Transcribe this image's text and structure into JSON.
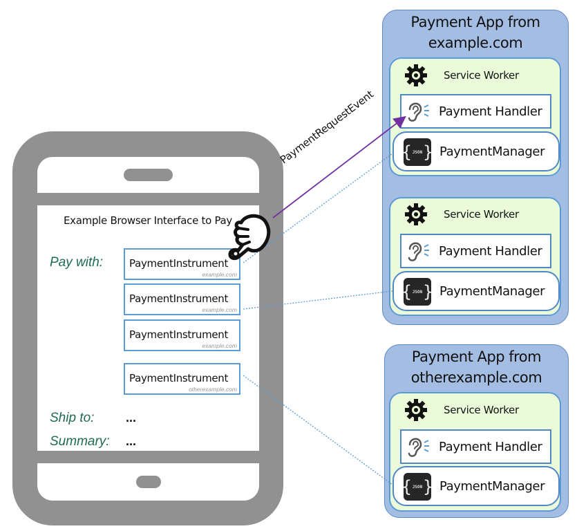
{
  "phone": {
    "browser_title": "Example Browser Interface to Pay",
    "pay_with_label": "Pay with:",
    "ship_to_label": "Ship to:",
    "ship_to_value": "...",
    "summary_label": "Summary:",
    "summary_value": "...",
    "instruments": [
      {
        "name": "PaymentInstrument",
        "origin": "example.com"
      },
      {
        "name": "PaymentInstrument",
        "origin": "example.com"
      },
      {
        "name": "PaymentInstrument",
        "origin": "example.com"
      },
      {
        "name": "PaymentInstrument",
        "origin": "otherexample.com"
      }
    ],
    "pointer_icon": "pointing-hand-icon"
  },
  "event_arrow": {
    "label": "PaymentRequestEvent",
    "color": "#7030a0"
  },
  "link_color": "#5b9bd5",
  "apps": [
    {
      "title_line1": "Payment App from",
      "title_line2": "example.com",
      "service_workers": [
        {
          "label": "Service Worker",
          "handler": "Payment Handler",
          "manager": "PaymentManager"
        },
        {
          "label": "Service Worker",
          "handler": "Payment Handler",
          "manager": "PaymentManager"
        }
      ]
    },
    {
      "title_line1": "Payment App from",
      "title_line2": "otherexample.com",
      "service_workers": [
        {
          "label": "Service Worker",
          "handler": "Payment Handler",
          "manager": "PaymentManager"
        }
      ]
    }
  ],
  "icons": {
    "gear": "gear-icon",
    "ear": "ear-icon",
    "json": "JSON"
  },
  "colors": {
    "phone_body": "#919191",
    "app_bg": "#a4bde3",
    "service_worker_bg": "#ebfbd9",
    "border_blue": "#5b9bd5",
    "label_green": "#1f6b4f"
  }
}
